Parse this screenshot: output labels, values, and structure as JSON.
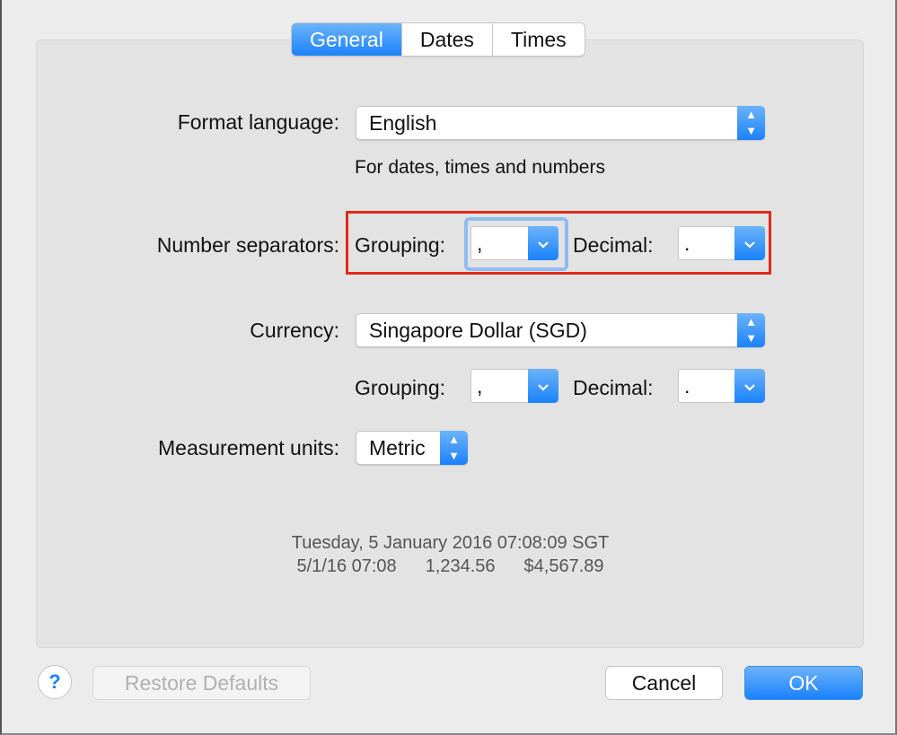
{
  "tabs": [
    {
      "label": "General",
      "active": true
    },
    {
      "label": "Dates"
    },
    {
      "label": "Times"
    }
  ],
  "format_language": {
    "label": "Format language:",
    "value": "English",
    "hint": "For dates, times and numbers"
  },
  "number_separators": {
    "label": "Number separators:",
    "grouping_label": "Grouping:",
    "grouping_value": ",",
    "decimal_label": "Decimal:",
    "decimal_value": "."
  },
  "currency": {
    "label": "Currency:",
    "value": "Singapore Dollar (SGD)",
    "grouping_label": "Grouping:",
    "grouping_value": ",",
    "decimal_label": "Decimal:",
    "decimal_value": "."
  },
  "measurement": {
    "label": "Measurement units:",
    "value": "Metric"
  },
  "preview": {
    "line1": "Tuesday, 5 January 2016 07:08:09 SGT",
    "date": "5/1/16 07:08",
    "number": "1,234.56",
    "currency": "$4,567.89"
  },
  "buttons": {
    "help": "?",
    "restore": "Restore Defaults",
    "cancel": "Cancel",
    "ok": "OK"
  },
  "colors": {
    "accent": "#1a82fb",
    "highlight": "#e02a1a",
    "focus_ring": "#8fbcef"
  }
}
